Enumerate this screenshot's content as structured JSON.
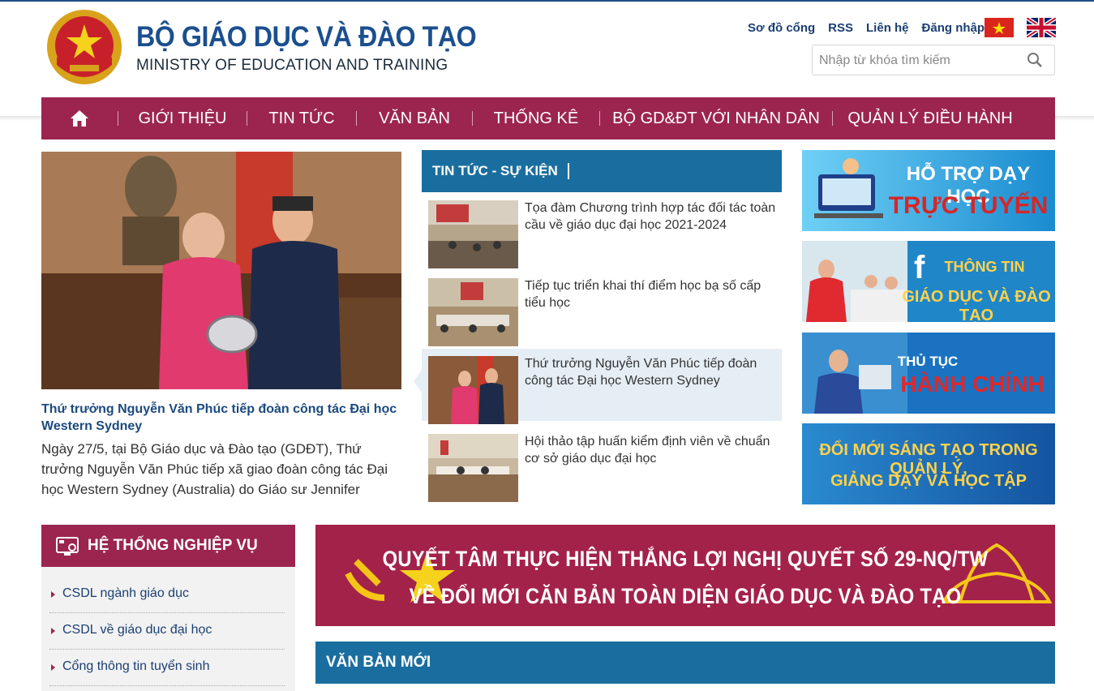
{
  "header": {
    "title": "BỘ GIÁO DỤC VÀ ĐÀO TẠO",
    "subtitle": "MINISTRY OF EDUCATION AND TRAINING",
    "links": [
      "Sơ đồ cổng",
      "RSS",
      "Liên hệ",
      "Đăng nhập"
    ],
    "search_placeholder": "Nhập từ khóa tìm kiếm"
  },
  "nav": {
    "items": [
      "GIỚI THIỆU",
      "TIN TỨC",
      "VĂN BẢN",
      "THỐNG KÊ",
      "BỘ GD&ĐT VỚI NHÂN DÂN",
      "QUẢN LÝ ĐIỀU HÀNH"
    ]
  },
  "featured": {
    "title": "Thứ trưởng Nguyễn Văn Phúc tiếp đoàn công tác Đại học Western Sydney",
    "summary": "Ngày 27/5, tại Bộ Giáo dục và Đào tạo (GDĐT), Thứ trưởng Nguyễn Văn Phúc tiếp xã giao đoàn công tác Đại học Western Sydney (Australia) do Giáo sư Jennifer"
  },
  "news": {
    "heading": "TIN TỨC - SỰ KIỆN",
    "items": [
      {
        "title": "Tọa đàm Chương trình hợp tác đối tác toàn cầu về giáo dục đại học 2021-2024"
      },
      {
        "title": "Tiếp tục triển khai thí điểm học bạ số cấp tiểu học"
      },
      {
        "title": "Thứ trưởng Nguyễn Văn Phúc tiếp đoàn công tác Đại học Western Sydney"
      },
      {
        "title": "Hội thảo tập huấn kiểm định viên về chuẩn cơ sở giáo dục đại học"
      }
    ]
  },
  "banners": {
    "b1": [
      "HỖ TRỢ DẠY HỌC",
      "TRỰC TUYẾN"
    ],
    "b2": [
      "THÔNG TIN",
      "GIÁO DỤC VÀ ĐÀO TẠO"
    ],
    "b3": [
      "THỦ TỤC",
      "HÀNH CHÍNH"
    ],
    "b4": [
      "ĐỔI MỚI SÁNG TẠO TRONG QUẢN LÝ,",
      "GIẢNG DẠY VÀ HỌC TẬP"
    ]
  },
  "sidebar": {
    "heading": "HỆ THỐNG NGHIỆP VỤ",
    "links": [
      "CSDL ngành giáo dục",
      "CSDL về giáo dục đại học",
      "Cổng thông tin tuyển sinh"
    ]
  },
  "wide_banner": {
    "line1": "QUYẾT TÂM THỰC HIỆN THẮNG LỢI NGHỊ QUYẾT SỐ 29-NQ/TW",
    "line2": "VỀ ĐỔI MỚI CĂN BẢN TOÀN DIỆN GIÁO DỤC VÀ ĐÀO TẠO"
  },
  "van_ban_moi": {
    "heading": "VĂN BẢN MỚI"
  },
  "colors": {
    "primary": "#9c2550",
    "secondary": "#1a6e9f",
    "title_blue": "#1b4f8f"
  }
}
